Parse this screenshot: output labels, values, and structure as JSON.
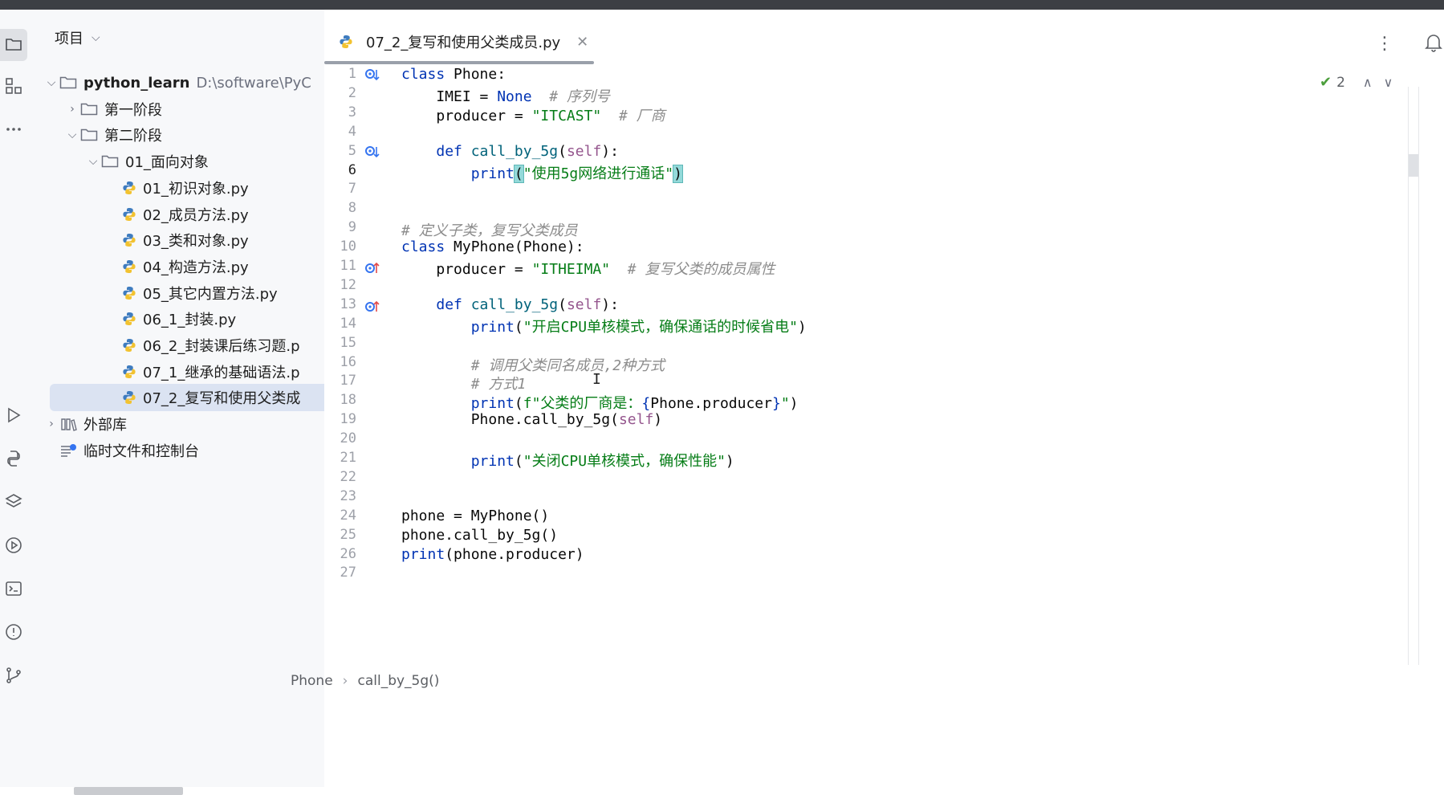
{
  "left_strip": {
    "icons": [
      "folder-icon",
      "structure-icon",
      "more-icon",
      "run-icon",
      "python-console-icon",
      "layers-icon",
      "services-icon",
      "terminal-icon",
      "problems-icon",
      "git-icon"
    ]
  },
  "project": {
    "header": "项目",
    "tree": [
      {
        "label": "python_learn",
        "hint": "D:\\software\\PyC",
        "type": "folder",
        "depth": 0,
        "expanded": true
      },
      {
        "label": "第一阶段",
        "type": "folder",
        "depth": 1,
        "expanded": false
      },
      {
        "label": "第二阶段",
        "type": "folder",
        "depth": 1,
        "expanded": true
      },
      {
        "label": "01_面向对象",
        "type": "folder",
        "depth": 2,
        "expanded": true
      },
      {
        "label": "01_初识对象.py",
        "type": "py",
        "depth": 3
      },
      {
        "label": "02_成员方法.py",
        "type": "py",
        "depth": 3
      },
      {
        "label": "03_类和对象.py",
        "type": "py",
        "depth": 3
      },
      {
        "label": "04_构造方法.py",
        "type": "py",
        "depth": 3
      },
      {
        "label": "05_其它内置方法.py",
        "type": "py",
        "depth": 3
      },
      {
        "label": "06_1_封装.py",
        "type": "py",
        "depth": 3
      },
      {
        "label": "06_2_封装课后练习题.p",
        "type": "py",
        "depth": 3
      },
      {
        "label": "07_1_继承的基础语法.p",
        "type": "py",
        "depth": 3
      },
      {
        "label": "07_2_复写和使用父类成",
        "type": "py",
        "depth": 3,
        "selected": true
      },
      {
        "label": "外部库",
        "type": "lib",
        "depth": 0,
        "expanded": false
      },
      {
        "label": "临时文件和控制台",
        "type": "scratch",
        "depth": 0
      }
    ]
  },
  "editor": {
    "tab_label": "07_2_复写和使用父类成员.py",
    "inspection_count": "2",
    "current_line": 6,
    "line_numbers": [
      "1",
      "2",
      "3",
      "4",
      "5",
      "6",
      "7",
      "8",
      "9",
      "10",
      "11",
      "12",
      "13",
      "14",
      "15",
      "16",
      "17",
      "18",
      "19",
      "20",
      "21",
      "22",
      "23",
      "24",
      "25",
      "26",
      "27"
    ],
    "breadcrumb": [
      "Phone",
      "call_by_5g()"
    ]
  },
  "code_lines": [
    "class Phone:",
    "    IMEI = None  # 序列号",
    "    producer = \"ITCAST\"  # 厂商",
    "",
    "    def call_by_5g(self):",
    "        print(\"使用5g网络进行通话\")",
    "",
    "",
    "# 定义子类，复写父类成员",
    "class MyPhone(Phone):",
    "    producer = \"ITHEIMA\"  # 复写父类的成员属性",
    "",
    "    def call_by_5g(self):",
    "        print(\"开启CPU单核模式，确保通话的时候省电\")",
    "",
    "        # 调用父类同名成员,2种方式",
    "        # 方式1",
    "        print(f\"父类的厂商是：{Phone.producer}\")",
    "        Phone.call_by_5g(self)",
    "",
    "        print(\"关闭CPU单核模式，确保性能\")",
    "",
    "",
    "phone = MyPhone()",
    "phone.call_by_5g()",
    "print(phone.producer)",
    ""
  ]
}
